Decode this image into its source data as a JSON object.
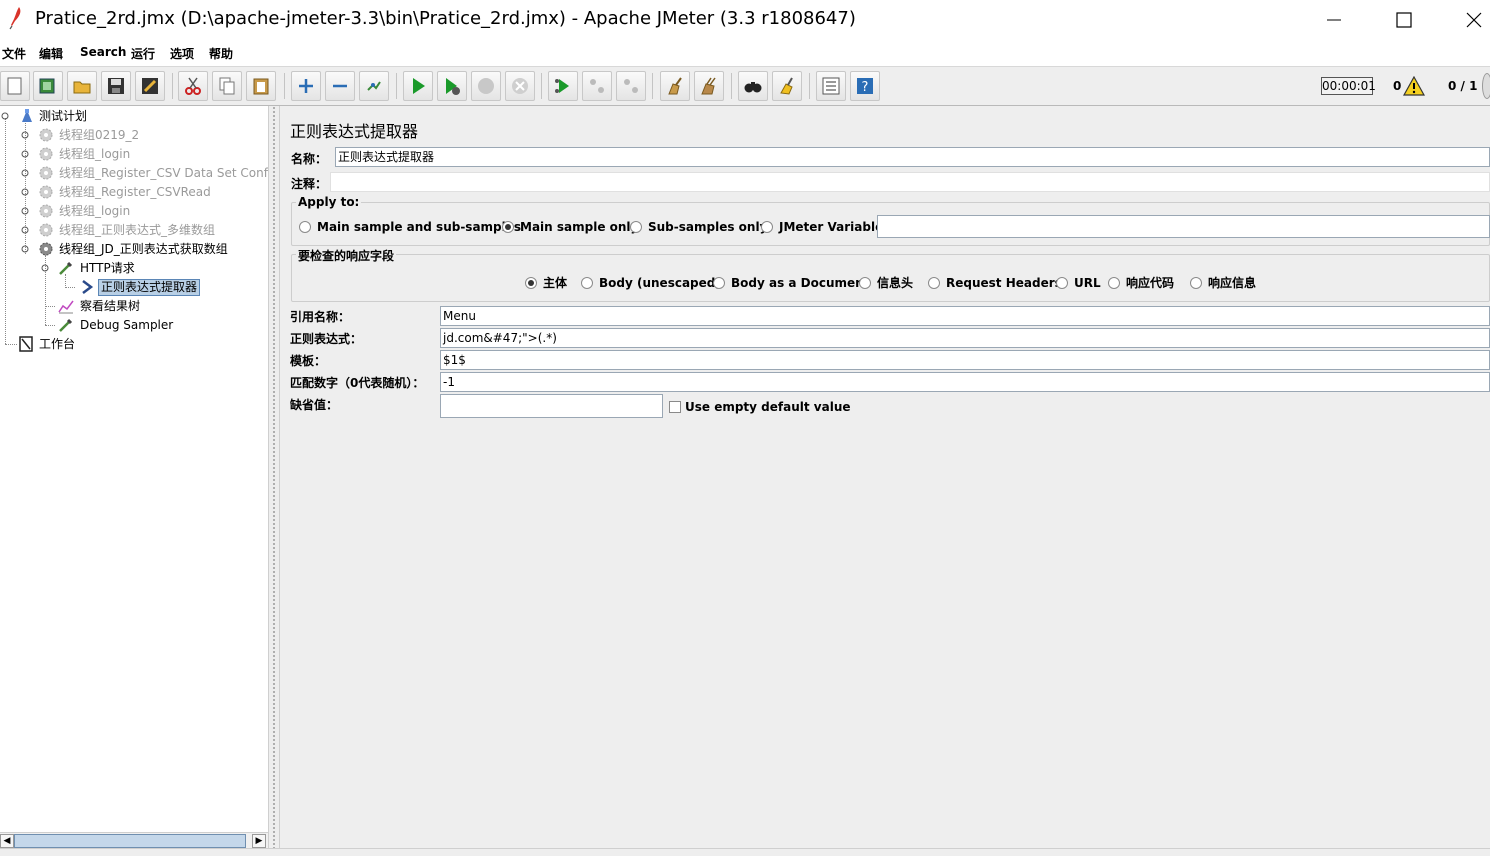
{
  "window": {
    "title": "Pratice_2rd.jmx (D:\\apache-jmeter-3.3\\bin\\Pratice_2rd.jmx) - Apache JMeter (3.3 r1808647)"
  },
  "menu": {
    "items": [
      "文件",
      "编辑",
      "Search",
      "运行",
      "选项",
      "帮助"
    ]
  },
  "toolbar": {
    "timer": "00:00:01",
    "error_count": "0",
    "threads": "0 / 1"
  },
  "tree": {
    "items": [
      {
        "label": "测试计划",
        "state": "enabled"
      },
      {
        "label": "线程组0219_2",
        "state": "disabled"
      },
      {
        "label": "线程组_login",
        "state": "disabled"
      },
      {
        "label": "线程组_Register_CSV Data Set Config",
        "state": "disabled"
      },
      {
        "label": "线程组_Register_CSVRead",
        "state": "disabled"
      },
      {
        "label": "线程组_login",
        "state": "disabled"
      },
      {
        "label": "线程组_正则表达式_多维数组",
        "state": "disabled"
      },
      {
        "label": "线程组_JD_正则表达式获取数组",
        "state": "enabled"
      },
      {
        "label": "HTTP请求",
        "state": "enabled"
      },
      {
        "label": "正则表达式提取器",
        "state": "selected"
      },
      {
        "label": "察看结果树",
        "state": "enabled"
      },
      {
        "label": "Debug Sampler",
        "state": "enabled"
      },
      {
        "label": "工作台",
        "state": "enabled"
      }
    ]
  },
  "panel": {
    "title": "正则表达式提取器",
    "name_label": "名称：",
    "name_value": "正则表达式提取器",
    "comment_label": "注释：",
    "comment_value": "",
    "apply_to": {
      "title": "Apply to:",
      "options": [
        "Main sample and sub-samples",
        "Main sample only",
        "Sub-samples only",
        "JMeter Variable"
      ],
      "selected": "Main sample only",
      "variable_value": ""
    },
    "response_field": {
      "title": "要检查的响应字段",
      "options": [
        "主体",
        "Body (unescaped)",
        "Body as a Document",
        "信息头",
        "Request Headers",
        "URL",
        "响应代码",
        "响应信息"
      ],
      "selected": "主体"
    },
    "ref_name_label": "引用名称：",
    "ref_name_value": "Menu",
    "regex_label": "正则表达式：",
    "regex_value": "jd.com&#47;\">(.*)",
    "template_label": "模板：",
    "template_value": "$1$",
    "match_no_label": "匹配数字（0代表随机）：",
    "match_no_value": "-1",
    "default_label": "缺省值：",
    "default_value": "",
    "use_empty_default_label": "Use empty default value",
    "use_empty_default_checked": false
  }
}
